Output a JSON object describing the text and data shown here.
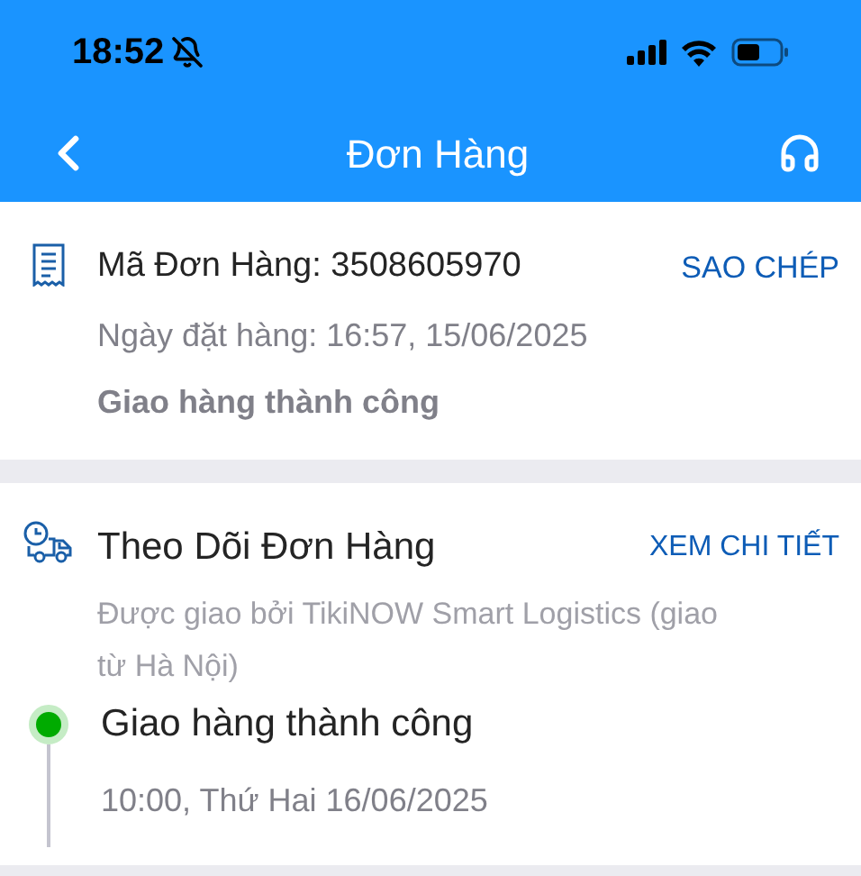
{
  "status_bar": {
    "time": "18:52"
  },
  "nav": {
    "title": "Đơn Hàng"
  },
  "order": {
    "code_label": "Mã Đơn Hàng: 3508605970",
    "copy": "SAO CHÉP",
    "date": "Ngày đặt hàng: 16:57, 15/06/2025",
    "status": "Giao hàng thành công"
  },
  "tracking": {
    "title": "Theo Dõi Đơn Hàng",
    "detail": "XEM CHI TIẾT",
    "carrier": "Được giao bởi TikiNOW Smart Logistics (giao từ Hà Nội)",
    "events": [
      {
        "title": "Giao hàng thành công",
        "time": "10:00, Thứ Hai 16/06/2025",
        "selected": true
      }
    ]
  }
}
